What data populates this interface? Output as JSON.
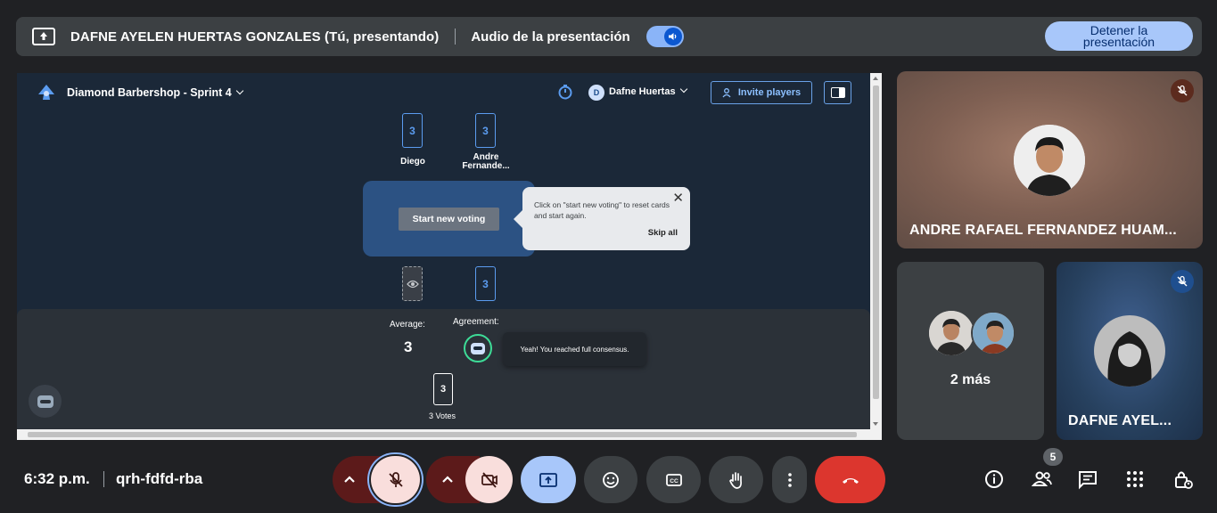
{
  "present_bar": {
    "presenter": "DAFNE AYELEN HUERTAS GONZALES (Tú, presentando)",
    "audio_label": "Audio de la presentación",
    "audio_enabled": true,
    "stop_button": "Detener la presentación"
  },
  "shared_app": {
    "board_title": "Diamond Barbershop - Sprint 4",
    "user_initial": "D",
    "user_name": "Dafne Huertas",
    "invite_button": "Invite players",
    "players": [
      {
        "name": "Diego",
        "card": "3"
      },
      {
        "name": "Andre Fernande...",
        "card": "3"
      },
      {
        "name": "",
        "card": ""
      },
      {
        "name": "",
        "card": "3"
      }
    ],
    "start_voting_button": "Start new voting",
    "tooltip": {
      "text": "Click on \"start new voting\" to reset cards and start again.",
      "close": "✕",
      "skip": "Skip all"
    },
    "results": {
      "average_label": "Average:",
      "average_value": "3",
      "agreement_label": "Agreement:",
      "consensus_message": "Yeah! You reached full consensus.",
      "vote_card": "3",
      "votes_text": "3 Votes"
    }
  },
  "participants": {
    "main": {
      "name": "ANDRE RAFAEL FERNANDEZ HUAM...",
      "muted": true
    },
    "more": {
      "label": "2 más"
    },
    "self": {
      "name": "DAFNE AYEL...",
      "muted": true
    }
  },
  "bottom_bar": {
    "time": "6:32 p.m.",
    "meeting_code": "qrh-fdfd-rba",
    "participant_count": "5"
  },
  "colors": {
    "background": "#202124",
    "accent_blue": "#a8c7fa",
    "end_call_red": "#dc362e",
    "agreement_green": "#3ddc97"
  }
}
